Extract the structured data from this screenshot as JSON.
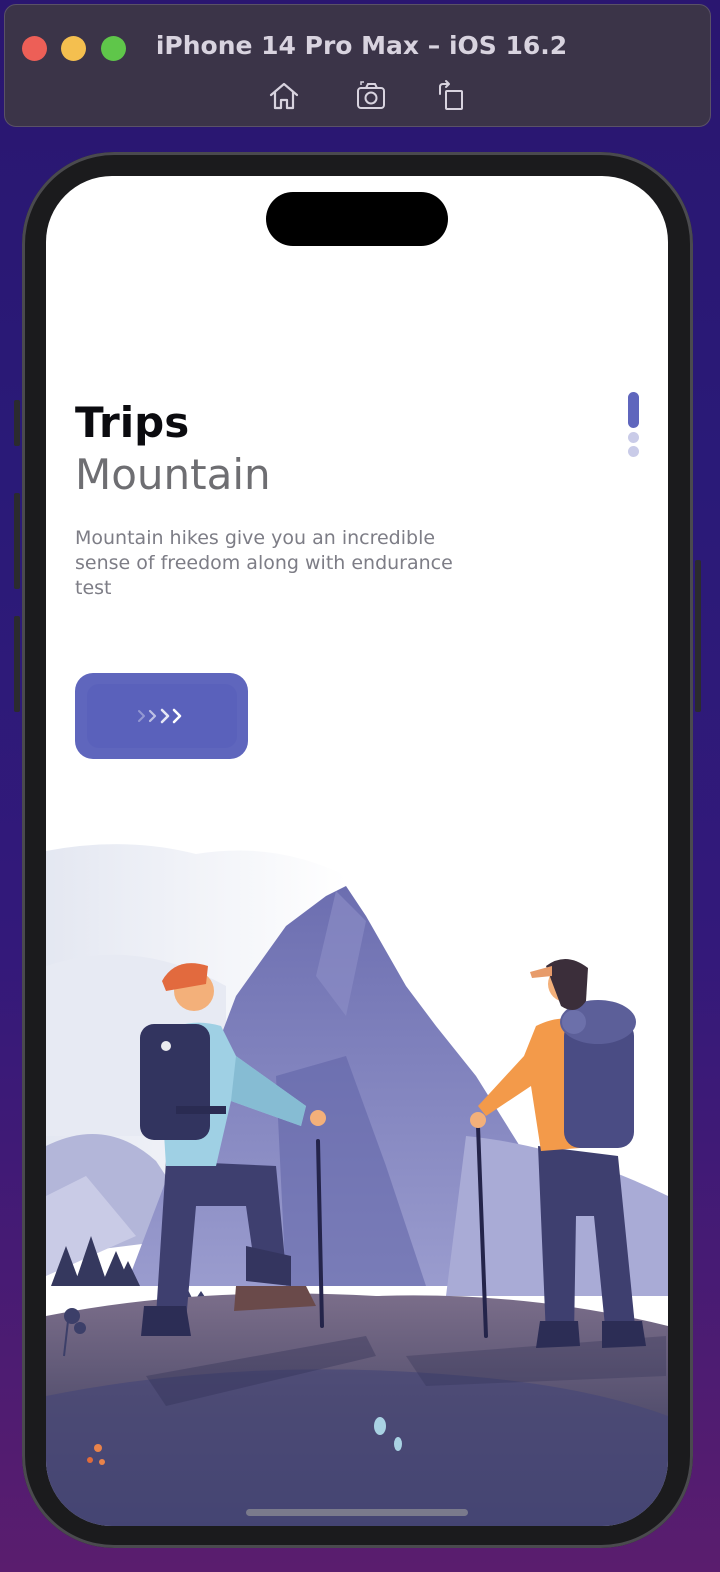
{
  "simulator": {
    "title": "iPhone 14 Pro Max – iOS 16.2",
    "toolbar_icons": [
      "home-icon",
      "screenshot-icon",
      "rotate-icon"
    ]
  },
  "app": {
    "title": "Trips",
    "subtitle": "Mountain",
    "description": "Mountain hikes give you an incredible sense of freedom along with endurance test",
    "button_label": ">>>>",
    "pager": {
      "total": 3,
      "active_index": 0
    }
  },
  "colors": {
    "accent": "#5f66bd",
    "pager_inactive": "#c9cbe8",
    "title": "#0b0b0f",
    "subtitle": "#6e6e72",
    "description": "#7d7d86"
  }
}
